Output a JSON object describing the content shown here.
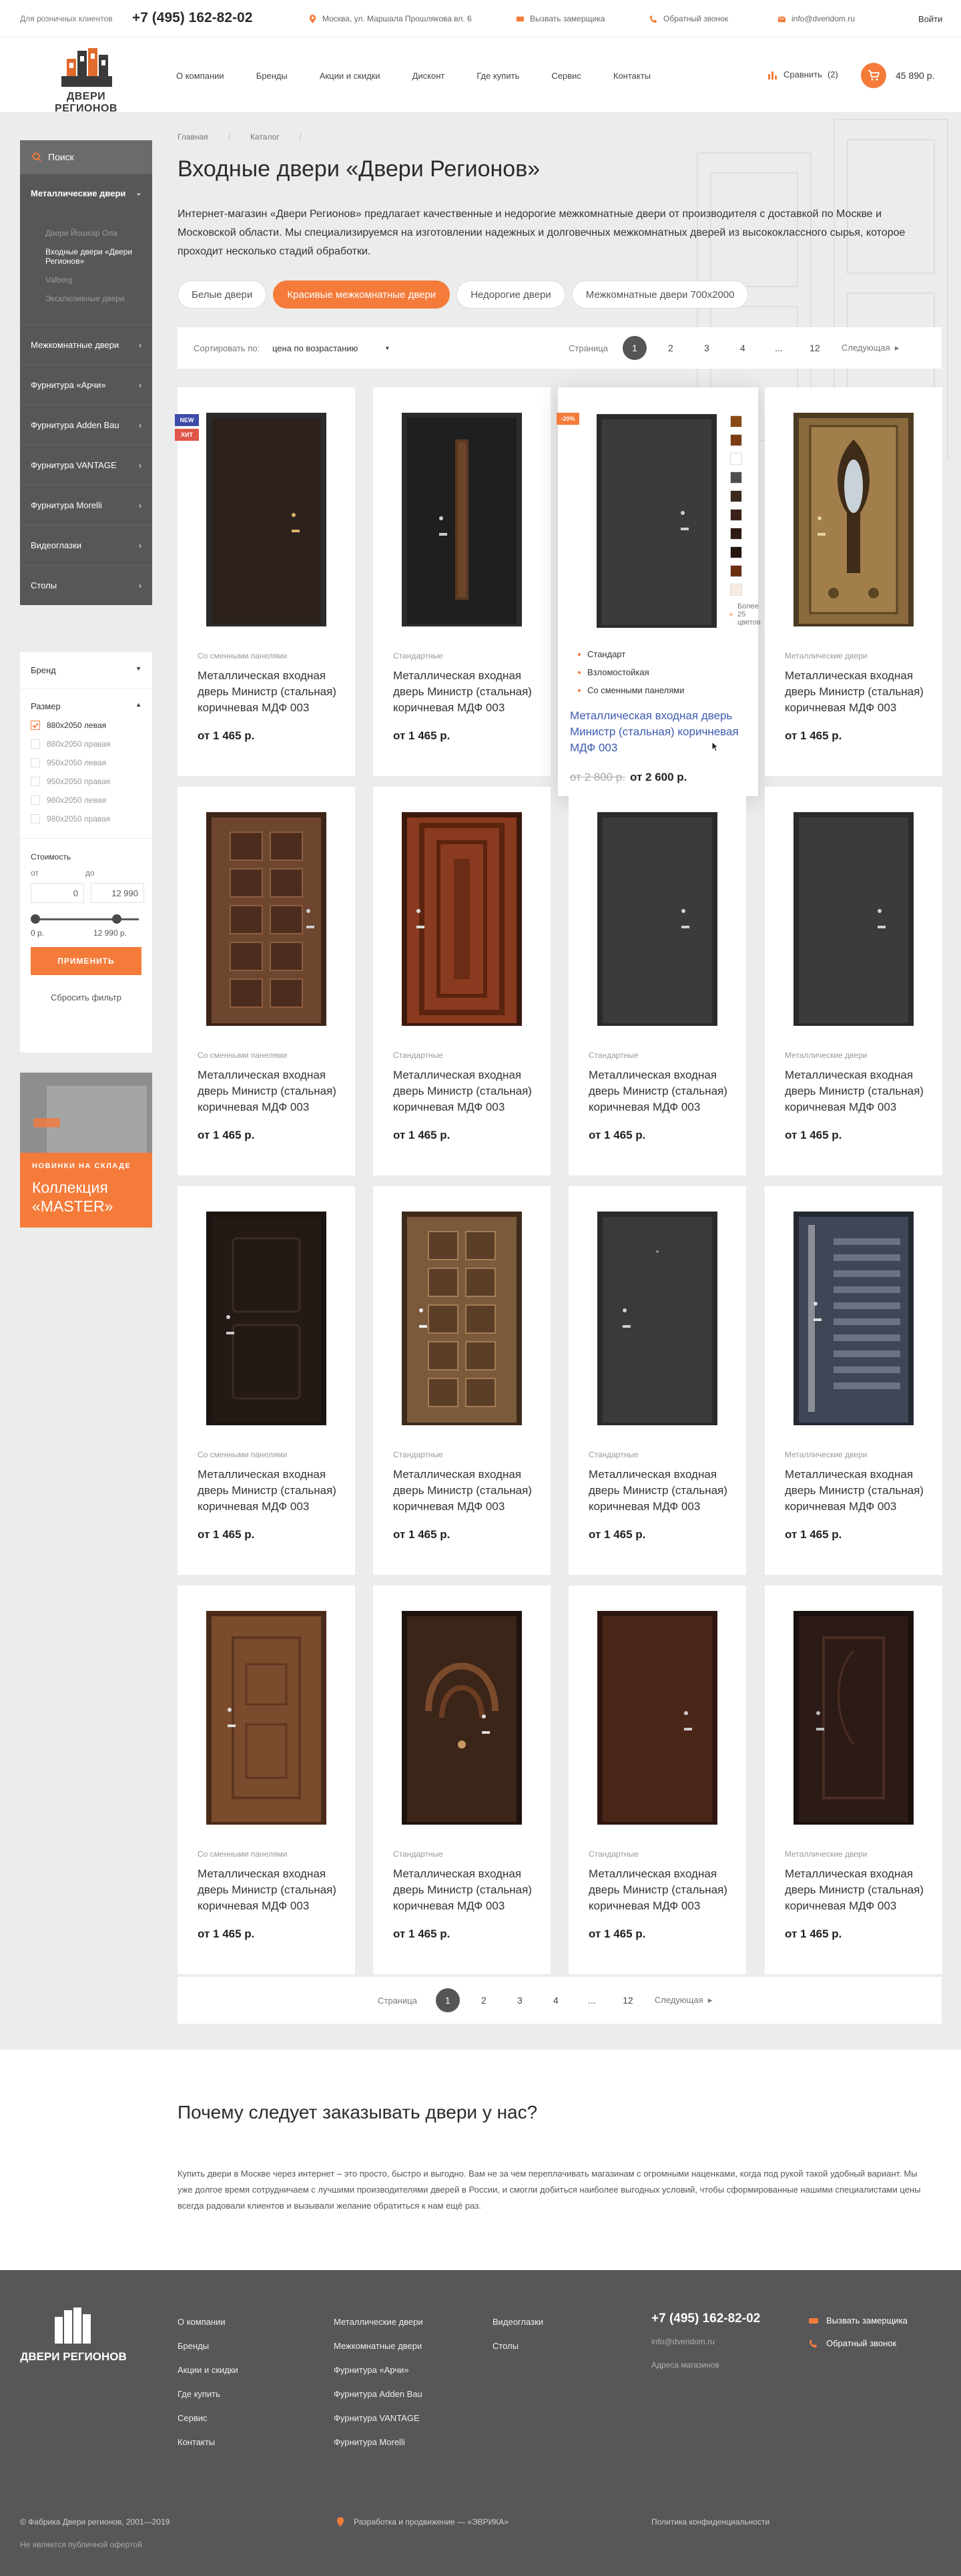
{
  "topbar": {
    "retail_label": "Для розничных клиентов",
    "phone": "+7 (495) 162-82-02",
    "address": "Москва, ул. Маршала Прошлякова вл. 6",
    "measurer": "Вызвать замерщика",
    "callback": "Обратный звонок",
    "email": "info@dveridom.ru",
    "login": "Войти"
  },
  "header": {
    "logo_text": "ДВЕРИ РЕГИОНОВ",
    "nav": [
      "О компании",
      "Бренды",
      "Акции и скидки",
      "Дисконт",
      "Где купить",
      "Сервис",
      "Контакты"
    ],
    "compare_label": "Сравнить",
    "compare_count": "(2)",
    "cart_total": "45 890 р."
  },
  "sidebar": {
    "search_label": "Поиск",
    "active_item": "Металлические двери",
    "sub_items": [
      "Двери Йошкар Ола",
      "Входные двери «Двери Регионов»",
      "Valberg",
      "Эксклюзивные двери"
    ],
    "items": [
      "Межкомнатные двери",
      "Фурнитура «Арчи»",
      "Фурнитура Adden Bau",
      "Фурнитура VANTAGE",
      "Фурнитура Morelli",
      "Видеоглазки",
      "Столы"
    ]
  },
  "filter": {
    "brand_label": "Бренд",
    "size_label": "Размер",
    "sizes": [
      "880х2050 левая",
      "880х2050 правая",
      "950х2050 левая",
      "950х2050 правая",
      "980х2050 левая",
      "980х2050 правая"
    ],
    "price_label": "Стоимость",
    "from_label": "от",
    "to_label": "до",
    "from_value": "0",
    "to_value": "12 990",
    "min_label": "0 р.",
    "max_label": "12 990 р.",
    "apply": "ПРИМЕНИТЬ",
    "reset": "Сбросить фильтр"
  },
  "banner": {
    "subtitle": "НОВИНКИ НА СКЛАДЕ",
    "title": "Коллекция «MASTER»"
  },
  "breadcrumbs": [
    "Главная",
    "Каталог"
  ],
  "page_title": "Входные двери «Двери Регионов»",
  "intro": "Интернет-магазин «Двери Регионов» предлагает качественные и недорогие межкомнатные двери от производителя с доставкой по Москве и Московской области. Мы специализируемся на изготовлении надежных и долговечных межкомнатных дверей из высококлассного сырья, которое проходит несколько стадий обработки.",
  "pills": [
    "Белые двери",
    "Красивые межкомнатные двери",
    "Недорогие двери",
    "Межкомнатные двери 700x2000"
  ],
  "sort": {
    "label": "Сортировать по:",
    "value": "цена по возрастанию",
    "page_label": "Страница",
    "pages": [
      "1",
      "2",
      "3",
      "4",
      "...",
      "12"
    ],
    "next": "Следующая"
  },
  "products": [
    {
      "cat": "Со сменными панелями",
      "name": "Металлическая входная дверь Министр (стальная) коричневая МДФ 003",
      "price": "от 1 465 р.",
      "badges": [
        "NEW",
        "ХИТ"
      ],
      "door": "dark"
    },
    {
      "cat": "Стандартные",
      "name": "Металлическая входная дверь Министр (стальная) коричневая МДФ 003",
      "price": "от 1 465 р.",
      "door": "black-strip"
    },
    {
      "cat": "",
      "name": "Металлическая входная дверь Министр (стальная) коричневая МДФ 003",
      "price": "от 2 600 р.",
      "old_price": "от 2 800 р.",
      "badges": [
        "-20%"
      ],
      "door": "gray",
      "features": [
        "Стандарт",
        "Взломостойкая",
        "Со сменными панелями"
      ],
      "more": "Более 25 цветов"
    },
    {
      "cat": "Металлические двери",
      "name": "Металлическая входная дверь Министр (стальная) коричневая МДФ 003",
      "price": "от 1 465 р.",
      "door": "ornate"
    },
    {
      "cat": "Со сменными панелями",
      "name": "Металлическая входная дверь Министр (стальная) коричневая МДФ 003",
      "price": "от 1 465 р.",
      "door": "panel-brown"
    },
    {
      "cat": "Стандартные",
      "name": "Металлическая входная дверь Министр (стальная) коричневая МДФ 003",
      "price": "от 1 465 р.",
      "door": "red-wood"
    },
    {
      "cat": "Стандартные",
      "name": "Металлическая входная дверь Министр (стальная) коричневая МДФ 003",
      "price": "от 1 465 р.",
      "door": "gray"
    },
    {
      "cat": "Металлические двери",
      "name": "Металлическая входная дверь Министр (стальная) коричневая МДФ 003",
      "price": "от 1 465 р.",
      "door": "gray"
    },
    {
      "cat": "Со сменными панелями",
      "name": "Металлическая входная дверь Министр (стальная) коричневая МДФ 003",
      "price": "от 1 465 р.",
      "door": "dark-classic"
    },
    {
      "cat": "Стандартные",
      "name": "Металлическая входная дверь Министр (стальная) коричневая МДФ 003",
      "price": "от 1 465 р.",
      "door": "panel-bronze"
    },
    {
      "cat": "Стандартные",
      "name": "Металлическая входная дверь Министр (стальная) коричневая МДФ 003",
      "price": "от 1 465 р.",
      "door": "graphite"
    },
    {
      "cat": "Металлические двери",
      "name": "Металлическая входная дверь Министр (стальная) коричневая МДФ 003",
      "price": "от 1 465 р.",
      "door": "blue-stripes"
    },
    {
      "cat": "Со сменными панелями",
      "name": "Металлическая входная дверь Министр (стальная) коричневая МДФ 003",
      "price": "от 1 465 р.",
      "door": "light-wood"
    },
    {
      "cat": "Стандартные",
      "name": "Металлическая входная дверь Министр (стальная) коричневая МДФ 003",
      "price": "от 1 465 р.",
      "door": "arches"
    },
    {
      "cat": "Стандартные",
      "name": "Металлическая входная дверь Министр (стальная) коричневая МДФ 003",
      "price": "от 1 465 р.",
      "door": "brown-metal"
    },
    {
      "cat": "Металлические двери",
      "name": "Металлическая входная дверь Министр (стальная) коричневая МДФ 003",
      "price": "от 1 465 р.",
      "door": "dark-wenge"
    }
  ],
  "swatch_colors": [
    "#8a4a16",
    "#7b3e12",
    "#ffffff",
    "#4e4e4e",
    "#3c2a1f",
    "#3a2219",
    "#2c1a12",
    "#24160f",
    "#6b2f12",
    "#f5ebe0"
  ],
  "why": {
    "title": "Почему следует заказывать двери у нас?",
    "text": "Купить двери в Москве через интернет – это просто, быстро и выгодно. Вам не за чем переплачивать магазинам с огромными наценками, когда под рукой такой удобный вариант. Мы уже долгое время сотрудничаем с лучшими производителями дверей в России, и смогли добиться наиболее выгодных условий, чтобы сформированные нашими специалистами цены всегда радовали клиентов и вызывали желание обратиться к нам ещё раз."
  },
  "footer": {
    "logo_text": "ДВЕРИ РЕГИОНОВ",
    "col1": [
      "О компании",
      "Бренды",
      "Акции и скидки",
      "Где купить",
      "Сервис",
      "Контакты"
    ],
    "col2": [
      "Металлические двери",
      "Межкомнатные двери",
      "Фурнитура «Арчи»",
      "Фурнитура Adden Bau",
      "Фурнитура VANTAGE",
      "Фурнитура Morelli"
    ],
    "col3": [
      "Видеоглазки",
      "Столы"
    ],
    "phone": "+7 (495) 162-82-02",
    "email": "info@dveridom.ru",
    "stores": "Адреса магазинов",
    "measurer": "Вызвать замерщика",
    "callback": "Обратный звонок",
    "copyright": "© Фабрика Двери регионов, 2001—2019",
    "offer": "Не является публичной офертой",
    "dev": "Разработка и продвижение — «ЭВРИКА»",
    "privacy": "Политика конфиденциальности"
  },
  "colors": {
    "accent": "#f47b3a",
    "sidebar": "#575757",
    "footer": "#57575a"
  }
}
